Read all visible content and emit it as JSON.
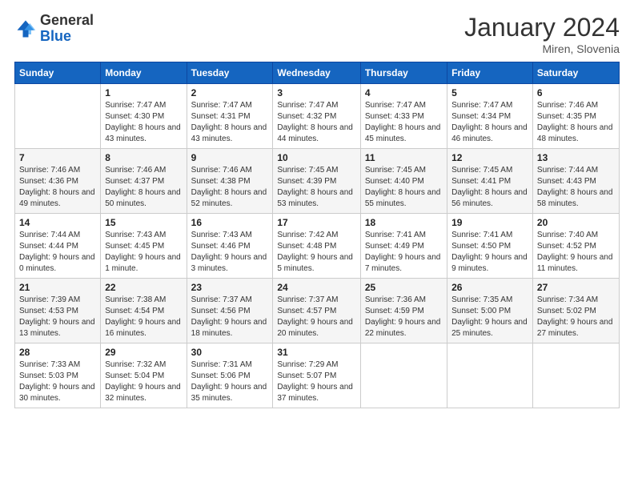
{
  "logo": {
    "general": "General",
    "blue": "Blue"
  },
  "header": {
    "title": "January 2024",
    "subtitle": "Miren, Slovenia"
  },
  "weekdays": [
    "Sunday",
    "Monday",
    "Tuesday",
    "Wednesday",
    "Thursday",
    "Friday",
    "Saturday"
  ],
  "weeks": [
    [
      {
        "num": "",
        "sunrise": "",
        "sunset": "",
        "daylight": ""
      },
      {
        "num": "1",
        "sunrise": "Sunrise: 7:47 AM",
        "sunset": "Sunset: 4:30 PM",
        "daylight": "Daylight: 8 hours and 43 minutes."
      },
      {
        "num": "2",
        "sunrise": "Sunrise: 7:47 AM",
        "sunset": "Sunset: 4:31 PM",
        "daylight": "Daylight: 8 hours and 43 minutes."
      },
      {
        "num": "3",
        "sunrise": "Sunrise: 7:47 AM",
        "sunset": "Sunset: 4:32 PM",
        "daylight": "Daylight: 8 hours and 44 minutes."
      },
      {
        "num": "4",
        "sunrise": "Sunrise: 7:47 AM",
        "sunset": "Sunset: 4:33 PM",
        "daylight": "Daylight: 8 hours and 45 minutes."
      },
      {
        "num": "5",
        "sunrise": "Sunrise: 7:47 AM",
        "sunset": "Sunset: 4:34 PM",
        "daylight": "Daylight: 8 hours and 46 minutes."
      },
      {
        "num": "6",
        "sunrise": "Sunrise: 7:46 AM",
        "sunset": "Sunset: 4:35 PM",
        "daylight": "Daylight: 8 hours and 48 minutes."
      }
    ],
    [
      {
        "num": "7",
        "sunrise": "Sunrise: 7:46 AM",
        "sunset": "Sunset: 4:36 PM",
        "daylight": "Daylight: 8 hours and 49 minutes."
      },
      {
        "num": "8",
        "sunrise": "Sunrise: 7:46 AM",
        "sunset": "Sunset: 4:37 PM",
        "daylight": "Daylight: 8 hours and 50 minutes."
      },
      {
        "num": "9",
        "sunrise": "Sunrise: 7:46 AM",
        "sunset": "Sunset: 4:38 PM",
        "daylight": "Daylight: 8 hours and 52 minutes."
      },
      {
        "num": "10",
        "sunrise": "Sunrise: 7:45 AM",
        "sunset": "Sunset: 4:39 PM",
        "daylight": "Daylight: 8 hours and 53 minutes."
      },
      {
        "num": "11",
        "sunrise": "Sunrise: 7:45 AM",
        "sunset": "Sunset: 4:40 PM",
        "daylight": "Daylight: 8 hours and 55 minutes."
      },
      {
        "num": "12",
        "sunrise": "Sunrise: 7:45 AM",
        "sunset": "Sunset: 4:41 PM",
        "daylight": "Daylight: 8 hours and 56 minutes."
      },
      {
        "num": "13",
        "sunrise": "Sunrise: 7:44 AM",
        "sunset": "Sunset: 4:43 PM",
        "daylight": "Daylight: 8 hours and 58 minutes."
      }
    ],
    [
      {
        "num": "14",
        "sunrise": "Sunrise: 7:44 AM",
        "sunset": "Sunset: 4:44 PM",
        "daylight": "Daylight: 9 hours and 0 minutes."
      },
      {
        "num": "15",
        "sunrise": "Sunrise: 7:43 AM",
        "sunset": "Sunset: 4:45 PM",
        "daylight": "Daylight: 9 hours and 1 minute."
      },
      {
        "num": "16",
        "sunrise": "Sunrise: 7:43 AM",
        "sunset": "Sunset: 4:46 PM",
        "daylight": "Daylight: 9 hours and 3 minutes."
      },
      {
        "num": "17",
        "sunrise": "Sunrise: 7:42 AM",
        "sunset": "Sunset: 4:48 PM",
        "daylight": "Daylight: 9 hours and 5 minutes."
      },
      {
        "num": "18",
        "sunrise": "Sunrise: 7:41 AM",
        "sunset": "Sunset: 4:49 PM",
        "daylight": "Daylight: 9 hours and 7 minutes."
      },
      {
        "num": "19",
        "sunrise": "Sunrise: 7:41 AM",
        "sunset": "Sunset: 4:50 PM",
        "daylight": "Daylight: 9 hours and 9 minutes."
      },
      {
        "num": "20",
        "sunrise": "Sunrise: 7:40 AM",
        "sunset": "Sunset: 4:52 PM",
        "daylight": "Daylight: 9 hours and 11 minutes."
      }
    ],
    [
      {
        "num": "21",
        "sunrise": "Sunrise: 7:39 AM",
        "sunset": "Sunset: 4:53 PM",
        "daylight": "Daylight: 9 hours and 13 minutes."
      },
      {
        "num": "22",
        "sunrise": "Sunrise: 7:38 AM",
        "sunset": "Sunset: 4:54 PM",
        "daylight": "Daylight: 9 hours and 16 minutes."
      },
      {
        "num": "23",
        "sunrise": "Sunrise: 7:37 AM",
        "sunset": "Sunset: 4:56 PM",
        "daylight": "Daylight: 9 hours and 18 minutes."
      },
      {
        "num": "24",
        "sunrise": "Sunrise: 7:37 AM",
        "sunset": "Sunset: 4:57 PM",
        "daylight": "Daylight: 9 hours and 20 minutes."
      },
      {
        "num": "25",
        "sunrise": "Sunrise: 7:36 AM",
        "sunset": "Sunset: 4:59 PM",
        "daylight": "Daylight: 9 hours and 22 minutes."
      },
      {
        "num": "26",
        "sunrise": "Sunrise: 7:35 AM",
        "sunset": "Sunset: 5:00 PM",
        "daylight": "Daylight: 9 hours and 25 minutes."
      },
      {
        "num": "27",
        "sunrise": "Sunrise: 7:34 AM",
        "sunset": "Sunset: 5:02 PM",
        "daylight": "Daylight: 9 hours and 27 minutes."
      }
    ],
    [
      {
        "num": "28",
        "sunrise": "Sunrise: 7:33 AM",
        "sunset": "Sunset: 5:03 PM",
        "daylight": "Daylight: 9 hours and 30 minutes."
      },
      {
        "num": "29",
        "sunrise": "Sunrise: 7:32 AM",
        "sunset": "Sunset: 5:04 PM",
        "daylight": "Daylight: 9 hours and 32 minutes."
      },
      {
        "num": "30",
        "sunrise": "Sunrise: 7:31 AM",
        "sunset": "Sunset: 5:06 PM",
        "daylight": "Daylight: 9 hours and 35 minutes."
      },
      {
        "num": "31",
        "sunrise": "Sunrise: 7:29 AM",
        "sunset": "Sunset: 5:07 PM",
        "daylight": "Daylight: 9 hours and 37 minutes."
      },
      {
        "num": "",
        "sunrise": "",
        "sunset": "",
        "daylight": ""
      },
      {
        "num": "",
        "sunrise": "",
        "sunset": "",
        "daylight": ""
      },
      {
        "num": "",
        "sunrise": "",
        "sunset": "",
        "daylight": ""
      }
    ]
  ]
}
